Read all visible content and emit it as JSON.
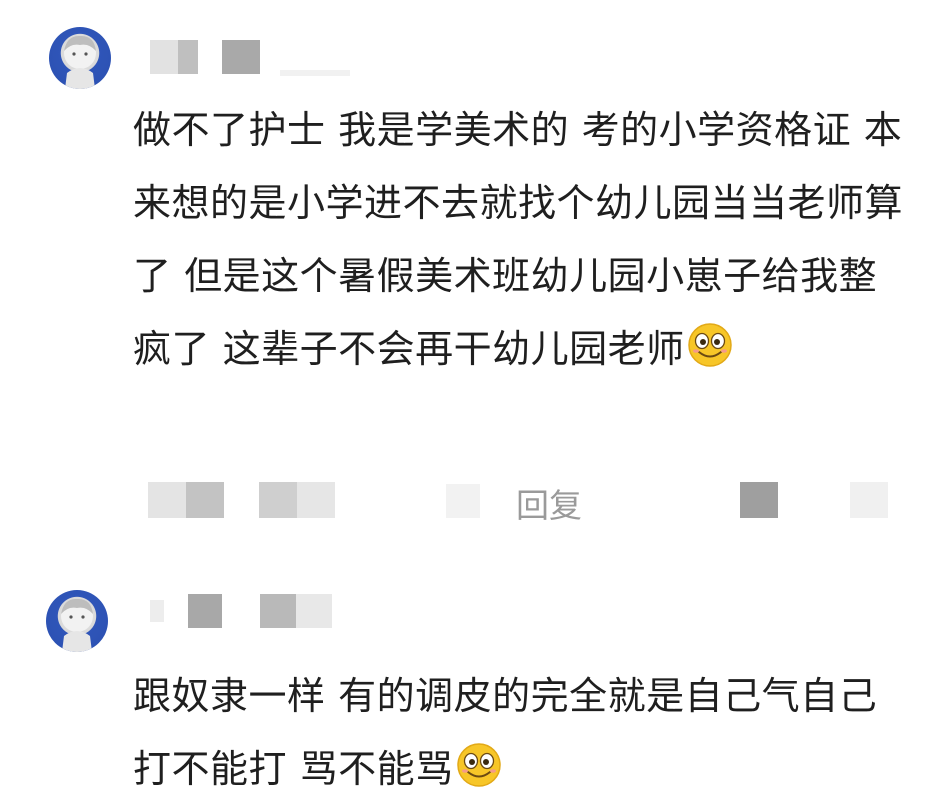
{
  "comments": [
    {
      "text": "做不了护士 我是学美术的 考的小学资格证 本来想的是小学进不去就找个幼儿园当当老师算了 但是这个暑假美术班幼儿园小崽子给我整疯了 这辈子不会再干幼儿园老师",
      "emoji": "smile-emoji-icon",
      "reply_label": "回复"
    },
    {
      "text": "跟奴隶一样 有的调皮的完全就是自己气自己 打不能打 骂不能骂",
      "emoji": "smile-emoji-icon"
    }
  ],
  "colors": {
    "text": "#1f1f1f",
    "reply": "#9a9a9a",
    "avatar_ring": "#2a4fb0",
    "emoji_face": "#f7c628"
  }
}
